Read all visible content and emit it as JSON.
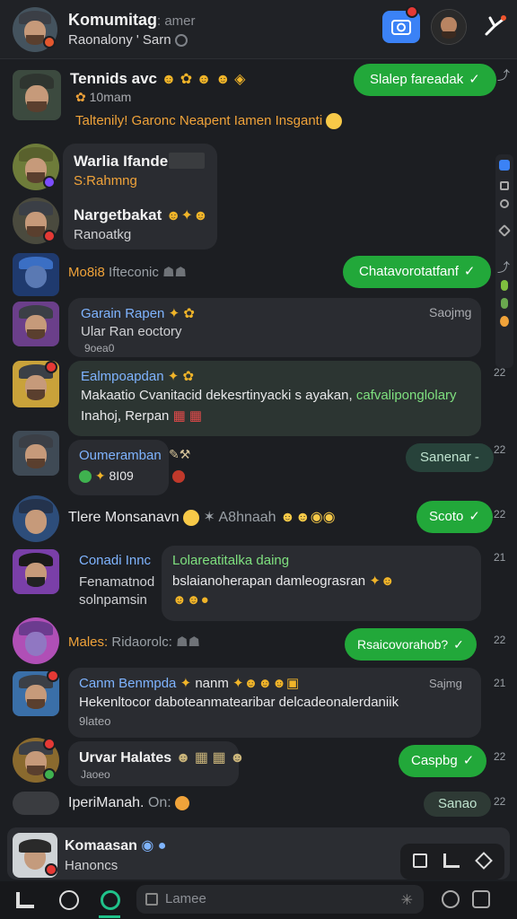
{
  "header": {
    "title": "Komumitag",
    "title_suffix": ": amer",
    "subtitle": "Raonalony ' Sarn"
  },
  "colors": {
    "accent_green": "#22a83a",
    "link_blue": "#7fb4ff",
    "orange": "#f0a33a",
    "camera_blue": "#3b82f6"
  },
  "icons": {
    "camera": "camera-icon",
    "sparkle": "sparkle-icon",
    "info": "info-icon"
  },
  "messages": [
    {
      "name": "Tennids avc",
      "time": "10mam",
      "text": "Taltenily! Garonc Neapent Iamen Insganti",
      "reply": "Slalep fareadak"
    },
    {
      "name": "Warlia Ifande",
      "sub": "S:Rahmng"
    },
    {
      "name": "Nargetbakat",
      "sub": "Ranoatkg"
    },
    {
      "name": "Mo8i8",
      "sub": "Ifteconic",
      "reply": "Chatavorotatfanf"
    },
    {
      "name": "Garain Rapen",
      "text": "Ular Ran eoctory",
      "time": "Saojmg",
      "sub": "9oea0"
    },
    {
      "name": "Ealmpoapdan",
      "text": "Makaatio Cvanitacid dekesrtinyacki s ayakan, ",
      "text2": "cafvaliponglolary",
      "text3": "Inahoj, Rerpan",
      "time_right": "22"
    },
    {
      "name": "Oumeramban",
      "sub": "8I09",
      "reply": "Sanenar -",
      "time_right": "22"
    },
    {
      "name": "Tlere Monsanavn",
      "extra": "A8hnaah",
      "reply": "Scoto",
      "time_right": "22"
    },
    {
      "name": "Conadi Innc",
      "sub": "Fenamatnod",
      "sub2": "solnpamsin",
      "quote_title": "Lolareatitalka daing",
      "quote_text": "bslaianoherapan damleograsran",
      "time_right": "21"
    },
    {
      "name": "Males:",
      "sub": "Ridaorolc:",
      "reply": "Rsaicovorahob?",
      "time_right": "22"
    },
    {
      "name": "Canm Benmpda",
      "extra": "nanm",
      "time": "Sajmg",
      "text": "Hekenltocor daboteanmatearibar delcadeonalerdaniik",
      "text2": "9lateo",
      "time_right": "21"
    },
    {
      "name": "Urvar Halates",
      "sub": "Jaoeo",
      "reply": "Caspbg",
      "time_right": "22"
    },
    {
      "name": "IperiManah.",
      "extra": "On:",
      "reply": "Sanao",
      "time_right": "22"
    }
  ],
  "composer": {
    "name": "Komaasan",
    "sub": "Hanoncs"
  },
  "navbar": {
    "search_placeholder": "Lamee"
  },
  "side_rail": [
    "C",
    "S",
    "O",
    "O",
    "&",
    "6",
    "A"
  ]
}
